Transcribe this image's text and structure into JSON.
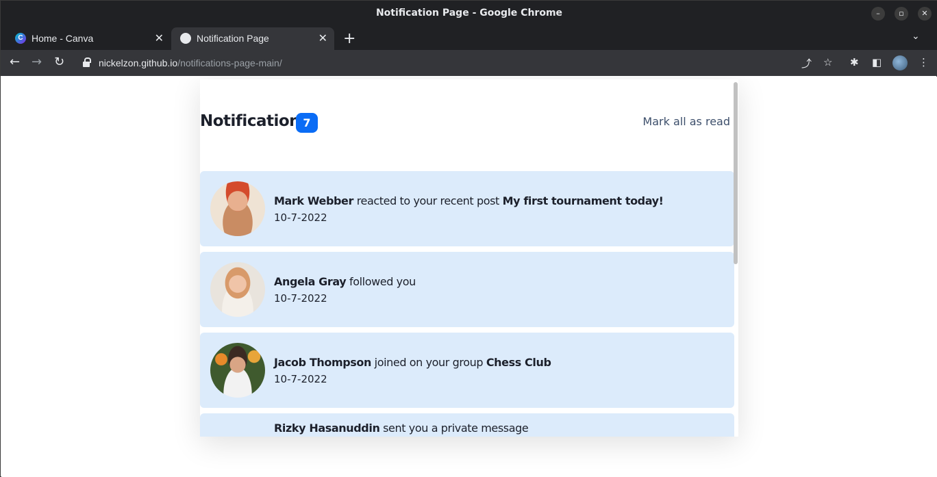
{
  "window": {
    "title": "Notification Page - Google Chrome",
    "min_glyph": "–",
    "max_glyph": "▫",
    "close_glyph": "✕"
  },
  "tabs": [
    {
      "label": "Home - Canva",
      "favicon_glyph": "C",
      "active": false
    },
    {
      "label": "Notification Page",
      "favicon_glyph": "",
      "active": true
    }
  ],
  "tab_close_glyph": "✕",
  "new_tab_glyph": "+",
  "tab_menu_glyph": "⌄",
  "toolbar": {
    "back_glyph": "←",
    "forward_glyph": "→",
    "reload_glyph": "↻",
    "url_host": "nickelzon.github.io",
    "url_path": "/notifications-page-main/",
    "share_glyph": "⤴",
    "star_glyph": "☆",
    "extensions_glyph": "✱",
    "sidepanel_glyph": "◧",
    "menu_glyph": "⋮"
  },
  "header": {
    "title": "Notifications",
    "unread_count": "7",
    "mark_all_label": "Mark all as read"
  },
  "notifications": [
    {
      "name": "Mark Webber",
      "action": "reacted to your recent post",
      "target": "My first tournament today!",
      "date": "10-7-2022"
    },
    {
      "name": "Angela Gray",
      "action": "followed you",
      "target": "",
      "date": "10-7-2022"
    },
    {
      "name": "Jacob Thompson",
      "action": "joined on your group",
      "target": "Chess Club",
      "date": "10-7-2022"
    },
    {
      "name": "Rizky Hasanuddin",
      "action": "sent you a private message",
      "target": "",
      "date": ""
    }
  ],
  "colors": {
    "badge": "#0a6cf5",
    "unread_bg": "#dcebfb",
    "heading": "#1c202b",
    "mark_all": "#3d4f6b"
  }
}
